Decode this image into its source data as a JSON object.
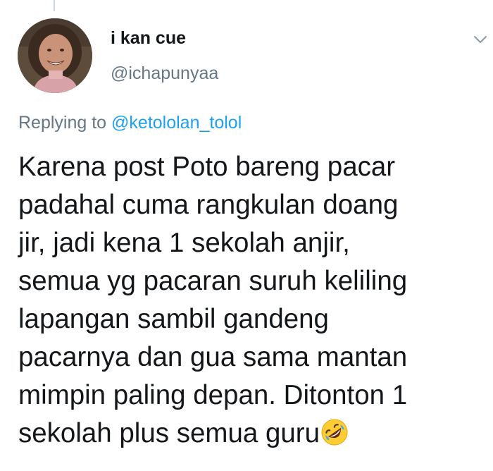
{
  "author": {
    "display_name": "i kan cue",
    "handle": "@ichapunyaa",
    "avatar_icon": "profile-photo"
  },
  "reply": {
    "prefix": "Replying to ",
    "mention": "@ketololan_tolol"
  },
  "tweet": {
    "lines": [
      "Karena post Poto bareng pacar",
      "padahal cuma rangkulan doang",
      "jir, jadi kena 1 sekolah anjir,",
      "semua yg pacaran suruh keliling",
      "lapangan sambil gandeng",
      "pacarnya dan gua sama mantan",
      "mimpin paling depan. Ditonton 1",
      "sekolah plus semua guru"
    ],
    "trailing_emoji": "rolling-on-floor-laughing-emoji"
  },
  "menu": {
    "icon": "chevron-down-icon"
  },
  "colors": {
    "text": "#14171a",
    "secondary": "#657786",
    "link": "#1da1f2",
    "thread_line": "#ccd6dd"
  }
}
